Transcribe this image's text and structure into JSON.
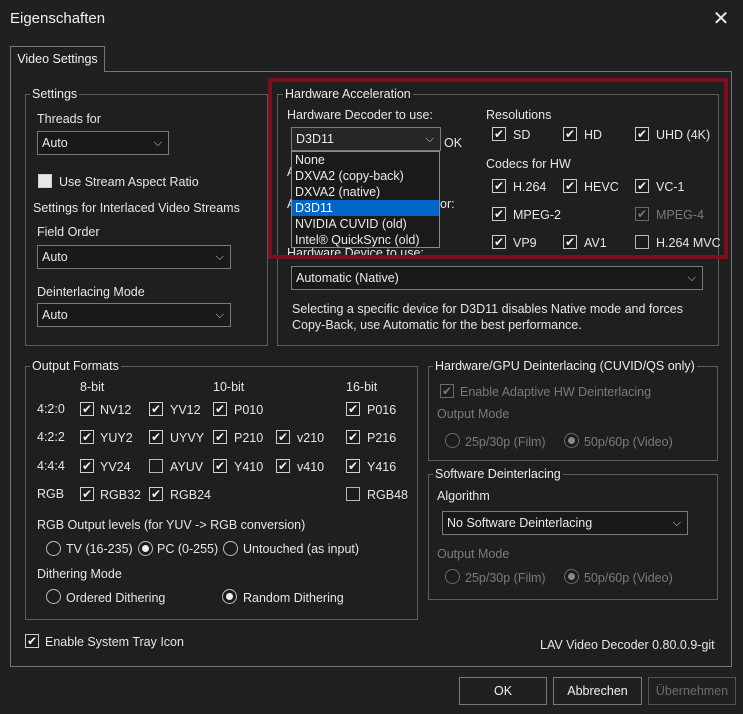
{
  "window": {
    "title": "Eigenschaften",
    "close": "✕"
  },
  "tab": {
    "label": "Video Settings"
  },
  "settings": {
    "group_label": "Settings",
    "threads_label": "Threads for",
    "threads_value": "Auto",
    "stream_aspect_label": "Use Stream Aspect Ratio",
    "stream_aspect_checked": true,
    "interlaced_label": "Settings for Interlaced Video Streams",
    "field_order_label": "Field Order",
    "field_order_value": "Auto",
    "deint_mode_label": "Deinterlacing Mode",
    "deint_mode_value": "Auto"
  },
  "hwaccel": {
    "group_label": "Hardware Acceleration",
    "decoder_label": "Hardware Decoder to use:",
    "decoder_value": "D3D11",
    "ok_partial": "OK",
    "obscured_label_1": "A",
    "obscured_label_2": "A",
    "obscured_suffix_2": "or:",
    "device_label": "Hardware Device to use:",
    "device_value": "Automatic (Native)",
    "info_text": "Selecting a specific device for D3D11 disables Native mode and forces Copy-Back, use Automatic for the best performance.",
    "dropdown_options": [
      "None",
      "DXVA2 (copy-back)",
      "DXVA2 (native)",
      "D3D11",
      "NVIDIA CUVID (old)",
      "Intel® QuickSync (old)"
    ],
    "resolutions_label": "Resolutions",
    "res_sd": "SD",
    "res_hd": "HD",
    "res_uhd": "UHD (4K)",
    "codecs_label": "Codecs for HW",
    "codec_h264": "H.264",
    "codec_hevc": "HEVC",
    "codec_vc1": "VC-1",
    "codec_mpeg2": "MPEG-2",
    "codec_mpeg4": "MPEG-4",
    "codec_vp9": "VP9",
    "codec_av1": "AV1",
    "codec_h264mvc": "H.264 MVC"
  },
  "output": {
    "group_label": "Output Formats",
    "col_8bit": "8-bit",
    "col_10bit": "10-bit",
    "col_16bit": "16-bit",
    "row_420": "4:2:0",
    "row_422": "4:2:2",
    "row_444": "4:4:4",
    "row_rgb": "RGB",
    "nv12": "NV12",
    "yv12": "YV12",
    "p010": "P010",
    "p016": "P016",
    "yuy2": "YUY2",
    "uyvy": "UYVY",
    "p210": "P210",
    "v210": "v210",
    "p216": "P216",
    "yv24": "YV24",
    "ayuv": "AYUV",
    "y410": "Y410",
    "v410": "v410",
    "y416": "Y416",
    "rgb32": "RGB32",
    "rgb24": "RGB24",
    "rgb48": "RGB48",
    "levels_label": "RGB Output levels (for YUV -> RGB conversion)",
    "tv": "TV (16-235)",
    "pc": "PC (0-255)",
    "untouched": "Untouched (as input)",
    "dither_label": "Dithering Mode",
    "ordered": "Ordered Dithering",
    "random": "Random Dithering"
  },
  "hwdeint": {
    "group_label": "Hardware/GPU Deinterlacing (CUVID/QS only)",
    "enable_label": "Enable Adaptive HW Deinterlacing",
    "output_mode_label": "Output Mode",
    "film": "25p/30p (Film)",
    "video": "50p/60p (Video)"
  },
  "swdeint": {
    "group_label": "Software Deinterlacing",
    "algorithm_label": "Algorithm",
    "algorithm_value": "No Software Deinterlacing",
    "output_mode_label": "Output Mode",
    "film": "25p/30p (Film)",
    "video": "50p/60p (Video)"
  },
  "footer": {
    "tray_label": "Enable System Tray Icon",
    "version": "LAV Video Decoder 0.80.0.9-git"
  },
  "buttons": {
    "ok": "OK",
    "cancel": "Abbrechen",
    "apply": "Übernehmen"
  },
  "icons": {
    "check": "✔",
    "chevron": "⌵"
  },
  "colors": {
    "selection": "#0064c8",
    "highlight_border": "#7d0f1c"
  }
}
